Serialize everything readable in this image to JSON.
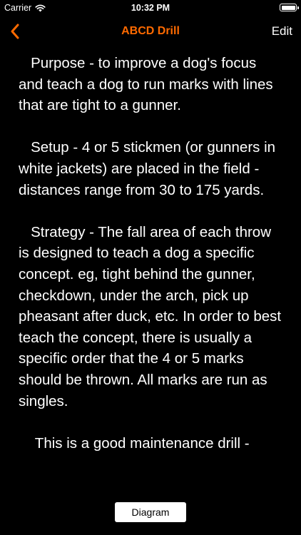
{
  "status_bar": {
    "carrier": "Carrier",
    "time": "10:32 PM",
    "icons": [
      "wifi-icon",
      "battery-icon"
    ]
  },
  "nav": {
    "title": "ABCD Drill",
    "edit_label": "Edit",
    "back_icon": "chevron-left-icon"
  },
  "content": {
    "text": "   Purpose - to improve a dog's focus and teach a dog to run marks with lines that are tight to a gunner.\n\n   Setup - 4 or 5 stickmen (or gunners in white jackets) are placed in the field - distances range from 30 to 175 yards.\n\n   Strategy - The fall area of each throw is designed to teach a dog a specific concept. eg, tight behind the gunner, checkdown, under the arch, pick up pheasant after duck, etc. In order to best teach the concept, there is usually a specific order that the 4 or 5 marks should be thrown. All marks are run as singles.\n\n    This is a good maintenance drill -"
  },
  "footer": {
    "diagram_label": "Diagram"
  },
  "colors": {
    "background": "#000000",
    "text": "#ffffff",
    "accent": "#ff6a00",
    "button_bg": "#ffffff",
    "button_text": "#000000"
  }
}
